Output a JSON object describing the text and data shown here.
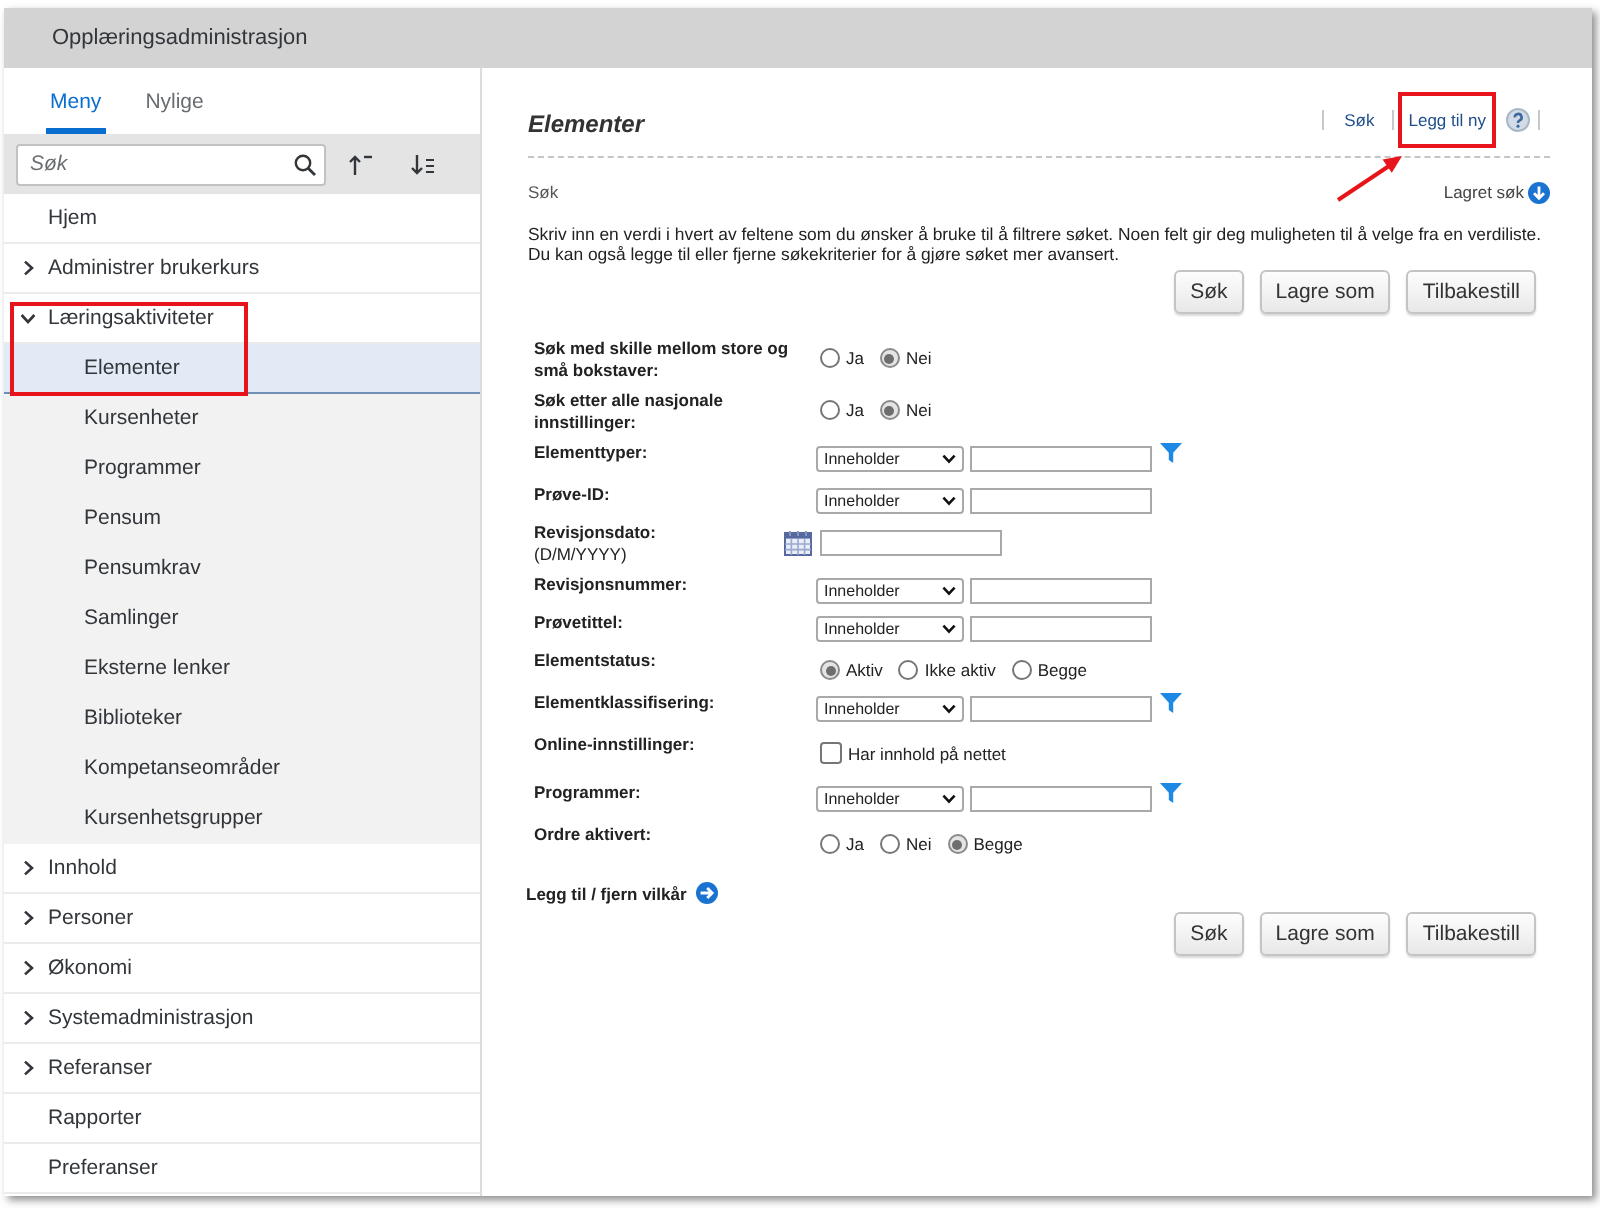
{
  "app": {
    "title": "Opplæringsadministrasjon"
  },
  "sidebar": {
    "tabs": [
      {
        "label": "Meny",
        "selected": true
      },
      {
        "label": "Nylige",
        "selected": false
      }
    ],
    "search": {
      "placeholder": "Søk"
    },
    "items": [
      {
        "kind": "link",
        "label": "Hjem",
        "selected": false,
        "highlighted": false
      },
      {
        "kind": "group",
        "label": "Administrer brukerkurs",
        "expanded": false,
        "selected": false,
        "highlighted": false
      },
      {
        "kind": "group",
        "label": "Læringsaktiviteter",
        "expanded": true,
        "selected": false,
        "highlighted": true,
        "children": [
          {
            "label": "Elementer",
            "selected": true
          },
          {
            "label": "Kursenheter",
            "selected": false
          },
          {
            "label": "Programmer",
            "selected": false
          },
          {
            "label": "Pensum",
            "selected": false
          },
          {
            "label": "Pensumkrav",
            "selected": false
          },
          {
            "label": "Samlinger",
            "selected": false
          },
          {
            "label": "Eksterne lenker",
            "selected": false
          },
          {
            "label": "Biblioteker",
            "selected": false
          },
          {
            "label": "Kompetanseområder",
            "selected": false
          },
          {
            "label": "Kursenhetsgrupper",
            "selected": false
          }
        ]
      },
      {
        "kind": "group",
        "label": "Innhold",
        "expanded": false,
        "selected": false,
        "highlighted": false
      },
      {
        "kind": "group",
        "label": "Personer",
        "expanded": false,
        "selected": false,
        "highlighted": false
      },
      {
        "kind": "group",
        "label": "Økonomi",
        "expanded": false,
        "selected": false,
        "highlighted": false
      },
      {
        "kind": "group",
        "label": "Systemadministrasjon",
        "expanded": false,
        "selected": false,
        "highlighted": false
      },
      {
        "kind": "group",
        "label": "Referanser",
        "expanded": false,
        "selected": false,
        "highlighted": false
      },
      {
        "kind": "link",
        "label": "Rapporter",
        "selected": false,
        "highlighted": false
      },
      {
        "kind": "link",
        "label": "Preferanser",
        "selected": false,
        "highlighted": false
      }
    ]
  },
  "page": {
    "title": "Elementer",
    "actions": [
      {
        "kind": "link",
        "label": "Søk",
        "highlighted": false
      },
      {
        "kind": "link",
        "label": "Legg til ny",
        "highlighted": true
      },
      {
        "kind": "help"
      }
    ],
    "callout_arrow": true,
    "section": "Søk",
    "saved_search": "Lagret søk",
    "instructions": "Skriv inn en verdi i hvert av feltene som du ønsker å bruke til å filtrere søket. Noen felt gir deg muligheten til å velge fra en verdiliste. Du kan også legge til eller fjerne søkekriterier for å gjøre søket mer avansert.",
    "buttons": [
      "Søk",
      "Lagre som",
      "Tilbakestill"
    ],
    "fields": [
      {
        "kind": "radio",
        "label": "Søk med skille mellom store og små bokstaver:",
        "options": [
          {
            "label": "Ja",
            "selected": false
          },
          {
            "label": "Nei",
            "selected": true
          }
        ]
      },
      {
        "kind": "radio",
        "label": "Søk etter alle nasjonale innstillinger:",
        "options": [
          {
            "label": "Ja",
            "selected": false
          },
          {
            "label": "Nei",
            "selected": true
          }
        ]
      },
      {
        "kind": "text",
        "label": "Elementtyper:",
        "operator": "Inneholder",
        "filter": true
      },
      {
        "kind": "text",
        "label": "Prøve-ID:",
        "operator": "Inneholder",
        "filter": false
      },
      {
        "kind": "date",
        "label": "Revisjonsdato:",
        "format_hint": "(D/M/YYYY)"
      },
      {
        "kind": "text",
        "label": "Revisjonsnummer:",
        "operator": "Inneholder",
        "filter": false
      },
      {
        "kind": "text",
        "label": "Prøvetittel:",
        "operator": "Inneholder",
        "filter": false
      },
      {
        "kind": "radio",
        "label": "Elementstatus:",
        "options": [
          {
            "label": "Aktiv",
            "selected": true
          },
          {
            "label": "Ikke aktiv",
            "selected": false
          },
          {
            "label": "Begge",
            "selected": false
          }
        ]
      },
      {
        "kind": "text",
        "label": "Elementklassifisering:",
        "operator": "Inneholder",
        "filter": true
      },
      {
        "kind": "checkbox",
        "label": "Online-innstillinger:",
        "option": {
          "label": "Har innhold på nettet",
          "checked": false
        }
      },
      {
        "kind": "text",
        "label": "Programmer:",
        "operator": "Inneholder",
        "filter": true
      },
      {
        "kind": "radio",
        "label": "Ordre aktivert:",
        "options": [
          {
            "label": "Ja",
            "selected": false
          },
          {
            "label": "Nei",
            "selected": false
          },
          {
            "label": "Begge",
            "selected": true
          }
        ]
      }
    ],
    "add_criteria": "Legg til / fjern vilkår",
    "bottom_buttons": [
      "Søk",
      "Lagre som",
      "Tilbakestill"
    ]
  }
}
